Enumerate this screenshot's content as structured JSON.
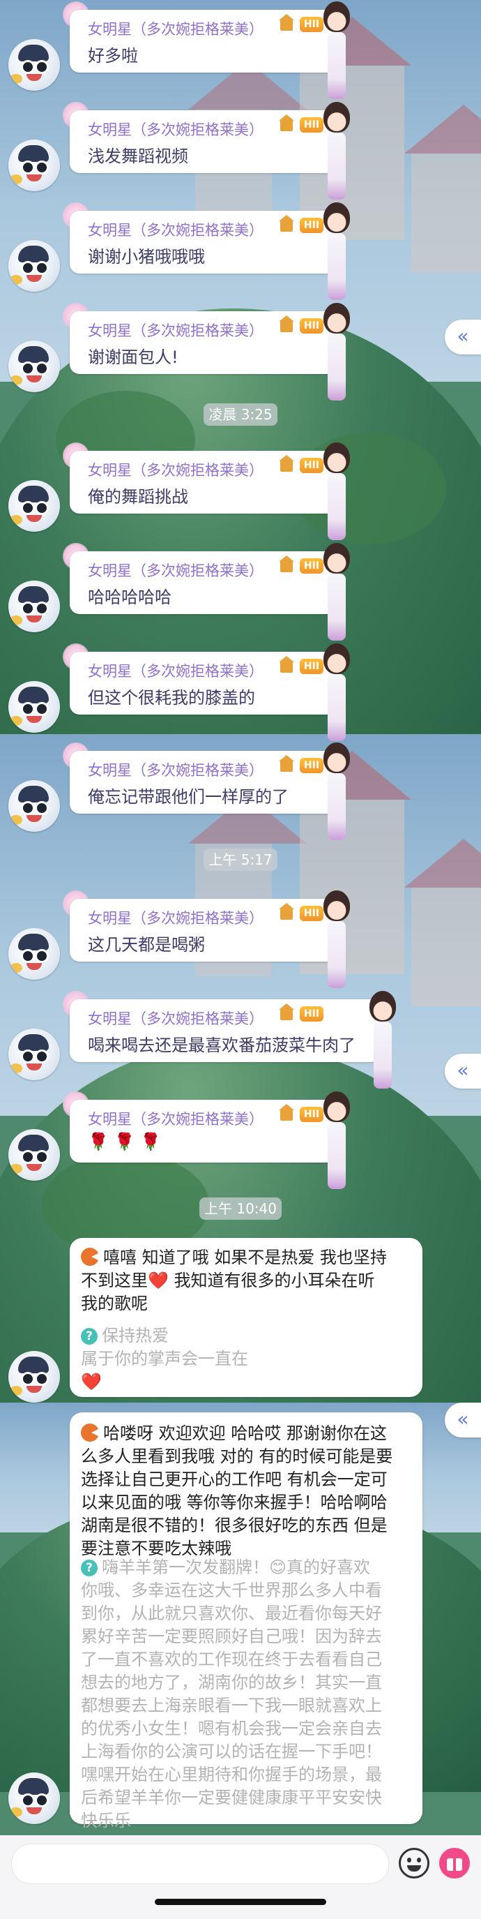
{
  "sender": {
    "name": "女明星（多次婉拒格莱美）",
    "level_badge": "HII"
  },
  "messages": [
    {
      "text": "好多啦"
    },
    {
      "text": "浅发舞蹈视频"
    },
    {
      "text": "谢谢小猪哦哦哦"
    },
    {
      "text": "谢谢面包人!"
    },
    {
      "text": "俺的舞蹈挑战"
    },
    {
      "text": "哈哈哈哈哈"
    },
    {
      "text": "但这个很耗我的膝盖的"
    },
    {
      "text": "俺忘记带跟他们一样厚的了"
    },
    {
      "text": "这几天都是喝粥"
    },
    {
      "text": "喝来喝去还是最喜欢番茄菠菜牛肉了"
    },
    {
      "text": "🌹 🌹 🌹"
    }
  ],
  "timestamps": [
    "凌晨 3:25",
    "上午 5:17",
    "上午 10:40"
  ],
  "replies": [
    {
      "lines": [
        "嘻嘻 知道了哦 如果不是热爱 我也坚持",
        "不到这里❤️ 我知道有很多的小耳朵在听",
        "我的歌呢"
      ],
      "quote_lines": [
        "保持热爱",
        "属于你的掌声会一直在",
        "❤️"
      ]
    },
    {
      "lines": [
        "哈喽呀 欢迎欢迎 哈哈哎 那谢谢你在这",
        "么多人里看到我哦 对的 有的时候可能是要",
        "选择让自己更开心的工作吧 有机会一定可",
        "以来见面的哦 等你等你来握手！哈哈啊哈",
        "湖南是很不错的！很多很好吃的东西 但是",
        "要注意不要吃太辣哦"
      ],
      "quote_lines": [
        "嗨羊羊第一次发翻牌！😊真的好喜欢",
        "你哦、多幸运在这大千世界那么多人中看",
        "到你，从此就只喜欢你、最近看你每天好",
        "累好辛苦一定要照顾好自己哦！因为辞去",
        "了一直不喜欢的工作现在终于去看看自己",
        "想去的地方了，湖南你的故乡！其实一直",
        "都想要去上海亲眼看一下我一眼就喜欢上",
        "的优秀小女生！嗯有机会我一定会亲自去",
        "上海看你的公演可以的话在握一下手吧！",
        "嘿嘿开始在心里期待和你握手的场景，最",
        "后希望羊羊你一定要健健康康平平安安快",
        "快乐乐"
      ]
    }
  ],
  "side_tab_icon": "«",
  "icons": [
    "avatar",
    "flower-frame-icon",
    "home-icon",
    "level-badge",
    "girl-figure-icon",
    "pacman-icon",
    "question-icon",
    "emoji-icon",
    "gift-icon",
    "collapse-left-icon"
  ]
}
